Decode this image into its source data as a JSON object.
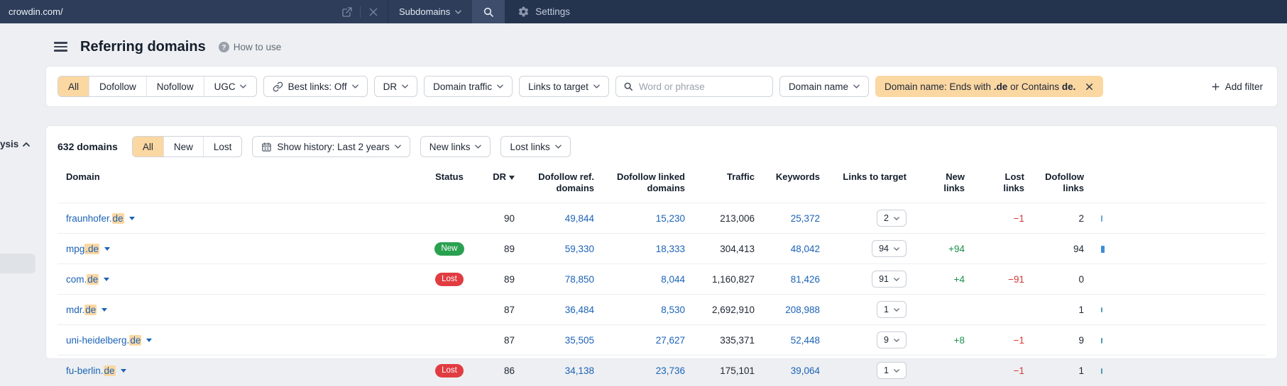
{
  "topbar": {
    "url_value": "crowdin.com/",
    "mode_selector_label": "Subdomains",
    "settings_label": "Settings"
  },
  "header": {
    "title": "Referring domains",
    "help_label": "How to use"
  },
  "filters": {
    "link_type_tabs": {
      "all": "All",
      "dofollow": "Dofollow",
      "nofollow": "Nofollow",
      "ugc": "UGC"
    },
    "best_links_label": "Best links: Off",
    "dr_label": "DR",
    "domain_traffic_label": "Domain traffic",
    "links_to_target_label": "Links to target",
    "search_placeholder": "Word or phrase",
    "domain_name_label": "Domain name",
    "active_filter": {
      "prefix": "Domain name: Ends with ",
      "bold1": ".de",
      "middle": " or Contains ",
      "bold2": "de."
    },
    "add_filter_label": "Add filter"
  },
  "toolbar": {
    "count_label": "632 domains",
    "status_tabs": {
      "all": "All",
      "new": "New",
      "lost": "Lost"
    },
    "show_history_label": "Show history: Last 2 years",
    "new_links_label": "New links",
    "lost_links_label": "Lost links"
  },
  "table": {
    "columns": [
      "Domain",
      "Status",
      "DR",
      "Dofollow ref. domains",
      "Dofollow linked domains",
      "Traffic",
      "Keywords",
      "Links to target",
      "New links",
      "Lost links",
      "Dofollow links"
    ],
    "rows": [
      {
        "domain_prefix": "fraunhofer.",
        "domain_hl": "de",
        "status": "",
        "dr": "90",
        "dofollow_ref": "49,844",
        "dofollow_linked": "15,230",
        "traffic": "213,006",
        "keywords": "25,372",
        "links_to_target": "2",
        "new_links": "",
        "lost_links": "−1",
        "dofollow_links": "2",
        "bar": {
          "w": 2,
          "h": 9,
          "color": "#69a9d8"
        }
      },
      {
        "domain_prefix": "mpg",
        "domain_hl": ".de",
        "status": "New",
        "dr": "89",
        "dofollow_ref": "59,330",
        "dofollow_linked": "18,333",
        "traffic": "304,413",
        "keywords": "48,042",
        "links_to_target": "94",
        "new_links": "+94",
        "lost_links": "",
        "dofollow_links": "94",
        "bar": {
          "w": 5,
          "h": 10,
          "color": "#3e8ed6"
        }
      },
      {
        "domain_prefix": "com.",
        "domain_hl": "de",
        "status": "Lost",
        "dr": "89",
        "dofollow_ref": "78,850",
        "dofollow_linked": "8,044",
        "traffic": "1,160,827",
        "keywords": "81,426",
        "links_to_target": "91",
        "new_links": "+4",
        "lost_links": "−91",
        "dofollow_links": "0",
        "bar": {
          "w": 0,
          "h": 0,
          "color": ""
        }
      },
      {
        "domain_prefix": "mdr.",
        "domain_hl": "de",
        "status": "",
        "dr": "87",
        "dofollow_ref": "36,484",
        "dofollow_linked": "8,530",
        "traffic": "2,692,910",
        "keywords": "208,988",
        "links_to_target": "1",
        "new_links": "",
        "lost_links": "",
        "dofollow_links": "1",
        "bar": {
          "w": 2,
          "h": 7,
          "color": "#4d9cb0"
        }
      },
      {
        "domain_prefix": "uni-heidelberg.",
        "domain_hl": "de",
        "status": "",
        "dr": "87",
        "dofollow_ref": "35,505",
        "dofollow_linked": "27,627",
        "traffic": "335,371",
        "keywords": "52,448",
        "links_to_target": "9",
        "new_links": "+8",
        "lost_links": "−1",
        "dofollow_links": "9",
        "bar": {
          "w": 2,
          "h": 8,
          "color": "#4d9cb0"
        }
      },
      {
        "domain_prefix": "fu-berlin.",
        "domain_hl": "de",
        "status": "Lost",
        "dr": "86",
        "dofollow_ref": "34,138",
        "dofollow_linked": "23,736",
        "traffic": "175,101",
        "keywords": "39,064",
        "links_to_target": "1",
        "new_links": "",
        "lost_links": "−1",
        "dofollow_links": "1",
        "bar": {
          "w": 2,
          "h": 8,
          "color": "#4d9cb0"
        }
      }
    ]
  },
  "left_partial": {
    "label": "ysis"
  },
  "colors": {
    "topbar_bg": "#24334e",
    "accent_peach": "#fbd7a2",
    "link_blue": "#1b63b7",
    "positive_green": "#1d9150",
    "negative_red": "#d63737",
    "pill_new": "#2aa150",
    "pill_lost": "#e13c41",
    "page_bg": "#edeff2"
  }
}
